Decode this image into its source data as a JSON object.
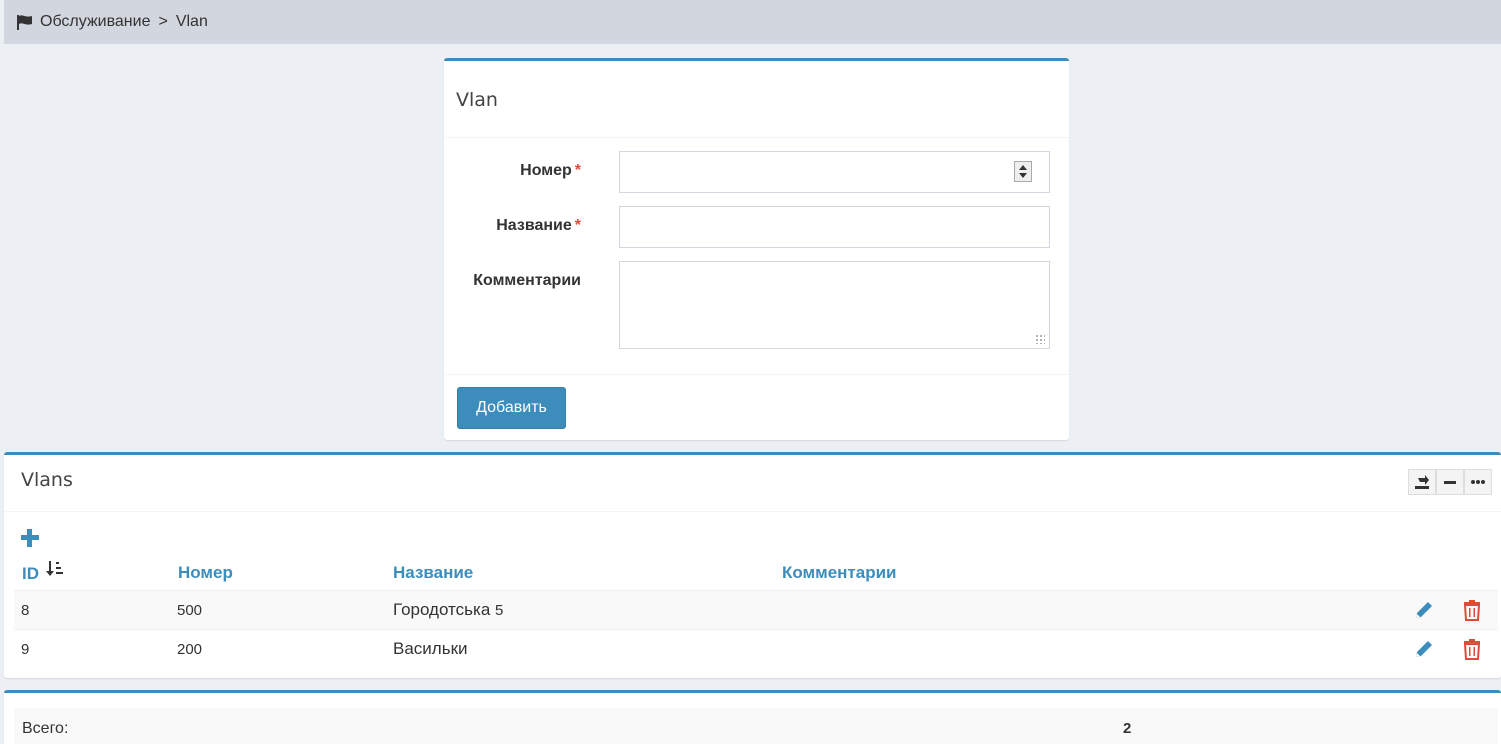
{
  "breadcrumb": {
    "section": "Обслуживание",
    "separator": ">",
    "page": "Vlan"
  },
  "form": {
    "title": "Vlan",
    "number_label": "Номер",
    "name_label": "Название",
    "comments_label": "Комментарии",
    "required_mark": "*",
    "number_value": "",
    "name_value": "",
    "comments_value": "",
    "submit_label": "Добавить"
  },
  "list": {
    "title": "Vlans",
    "columns": {
      "id": "ID",
      "number": "Номер",
      "name": "Название",
      "comments": "Комментарии"
    },
    "rows": [
      {
        "id": "8",
        "number": "500",
        "name": "Городотська",
        "name_suffix": "5",
        "comments": ""
      },
      {
        "id": "9",
        "number": "200",
        "name": "Васильки",
        "name_suffix": "",
        "comments": ""
      }
    ]
  },
  "summary": {
    "total_label": "Всего:",
    "total_value": "2"
  },
  "colors": {
    "accent": "#3c8dbc",
    "danger": "#dd4b39",
    "background": "#ecf0f5"
  },
  "icons": [
    "flag-icon",
    "export-icon",
    "minimize-icon",
    "more-icon",
    "plus-icon",
    "sort-desc-icon",
    "edit-icon",
    "delete-icon",
    "number-spinner-icon"
  ]
}
